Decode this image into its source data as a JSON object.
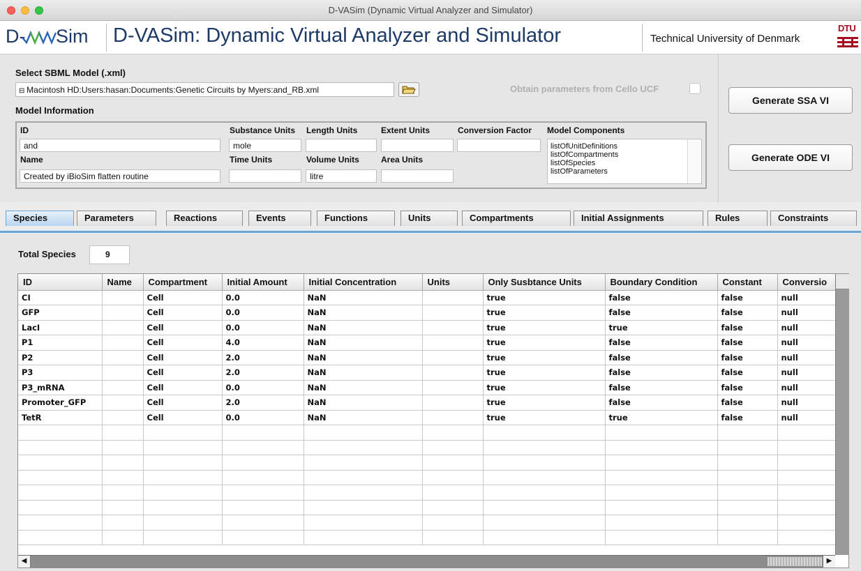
{
  "window": {
    "title": "D-VASim (Dynamic Virtual Analyzer and Simulator)"
  },
  "header": {
    "logo_left": "D-",
    "logo_right": "Sim",
    "app_title": "D-VASim: Dynamic Virtual Analyzer and Simulator",
    "university": "Technical University of Denmark",
    "dtu_mark": "DTU"
  },
  "model_select": {
    "label": "Select SBML Model (.xml)",
    "path": "Macintosh HD:Users:hasan:Documents:Genetic Circuits by Myers:and_RB.xml",
    "cello_label": "Obtain parameters from Cello UCF"
  },
  "buttons": {
    "ssa": "Generate SSA VI",
    "ode": "Generate ODE VI"
  },
  "model_info": {
    "title": "Model Information",
    "id_label": "ID",
    "id_value": "and",
    "name_label": "Name",
    "name_value": "Created by iBioSim flatten routine",
    "substance_units_label": "Substance Units",
    "substance_units_value": "mole",
    "time_units_label": "Time Units",
    "time_units_value": "",
    "length_units_label": "Length Units",
    "length_units_value": "",
    "volume_units_label": "Volume Units",
    "volume_units_value": "litre",
    "extent_units_label": "Extent Units",
    "extent_units_value": "",
    "area_units_label": "Area Units",
    "area_units_value": "",
    "conversion_factor_label": "Conversion Factor",
    "conversion_factor_value": "",
    "components_label": "Model Components",
    "components": [
      "listOfUnitDefinitions",
      "listOfCompartments",
      "listOfSpecies",
      "listOfParameters"
    ]
  },
  "tabs": [
    "Species",
    "Parameters",
    "Reactions",
    "Events",
    "Functions",
    "Units",
    "Compartments",
    "Initial Assignments",
    "Rules",
    "Constraints"
  ],
  "species": {
    "total_label": "Total Species",
    "total_value": "9",
    "columns": [
      "ID",
      "Name",
      "Compartment",
      "Initial Amount",
      "Initial Concentration",
      "Units",
      "Only Susbtance Units",
      "Boundary Condition",
      "Constant",
      "Conversio"
    ],
    "rows": [
      [
        "CI",
        "",
        "Cell",
        "0.0",
        "NaN",
        "",
        "true",
        "false",
        "false",
        "null"
      ],
      [
        "GFP",
        "",
        "Cell",
        "0.0",
        "NaN",
        "",
        "true",
        "false",
        "false",
        "null"
      ],
      [
        "LacI",
        "",
        "Cell",
        "0.0",
        "NaN",
        "",
        "true",
        "true",
        "false",
        "null"
      ],
      [
        "P1",
        "",
        "Cell",
        "4.0",
        "NaN",
        "",
        "true",
        "false",
        "false",
        "null"
      ],
      [
        "P2",
        "",
        "Cell",
        "2.0",
        "NaN",
        "",
        "true",
        "false",
        "false",
        "null"
      ],
      [
        "P3",
        "",
        "Cell",
        "2.0",
        "NaN",
        "",
        "true",
        "false",
        "false",
        "null"
      ],
      [
        "P3_mRNA",
        "",
        "Cell",
        "0.0",
        "NaN",
        "",
        "true",
        "false",
        "false",
        "null"
      ],
      [
        "Promoter_GFP",
        "",
        "Cell",
        "2.0",
        "NaN",
        "",
        "true",
        "false",
        "false",
        "null"
      ],
      [
        "TetR",
        "",
        "Cell",
        "0.0",
        "NaN",
        "",
        "true",
        "true",
        "false",
        "null"
      ]
    ],
    "empty_rows": 8
  }
}
